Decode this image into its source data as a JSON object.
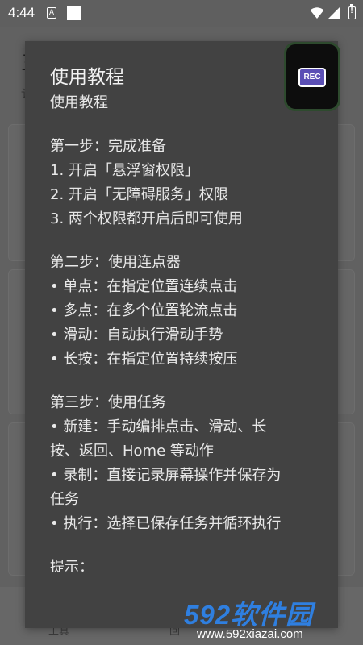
{
  "status_bar": {
    "time": "4:44",
    "indicator_letter": "A",
    "icons": [
      "a-notification-icon",
      "square-notification-icon",
      "wifi-icon",
      "signal-icon",
      "battery-alert-icon"
    ]
  },
  "background": {
    "title_fragment": "三",
    "subtitle_fragment": "讠",
    "nav": [
      "工具",
      "回"
    ]
  },
  "dialog": {
    "title": "使用教程",
    "lines": [
      "使用教程",
      "",
      "第一步：完成准备",
      "1. 开启「悬浮窗权限」",
      "2. 开启「无障碍服务」权限",
      "3. 两个权限都开启后即可使用",
      "",
      "第二步：使用连点器",
      "• 单点：在指定位置连续点击",
      "• 多点：在多个位置轮流点击",
      "• 滑动：自动执行滑动手势",
      "• 长按：在指定位置持续按压",
      "",
      "第三步：使用任务",
      "• 新建：手动编排点击、滑动、长",
      "按、返回、Home 等动作",
      "• 录制：直接记录屏幕操作并保存为",
      "任务",
      "• 执行：选择已保存任务并循环执行",
      "",
      "提示："
    ]
  },
  "floating": {
    "rec_label": "REC"
  },
  "watermark": {
    "main": "592软件园",
    "url": "www.592xiazai.com"
  },
  "colors": {
    "dialog_bg": "#424242",
    "rec_purple": "#5b4fb5",
    "watermark_blue": "#2f7fe0"
  }
}
